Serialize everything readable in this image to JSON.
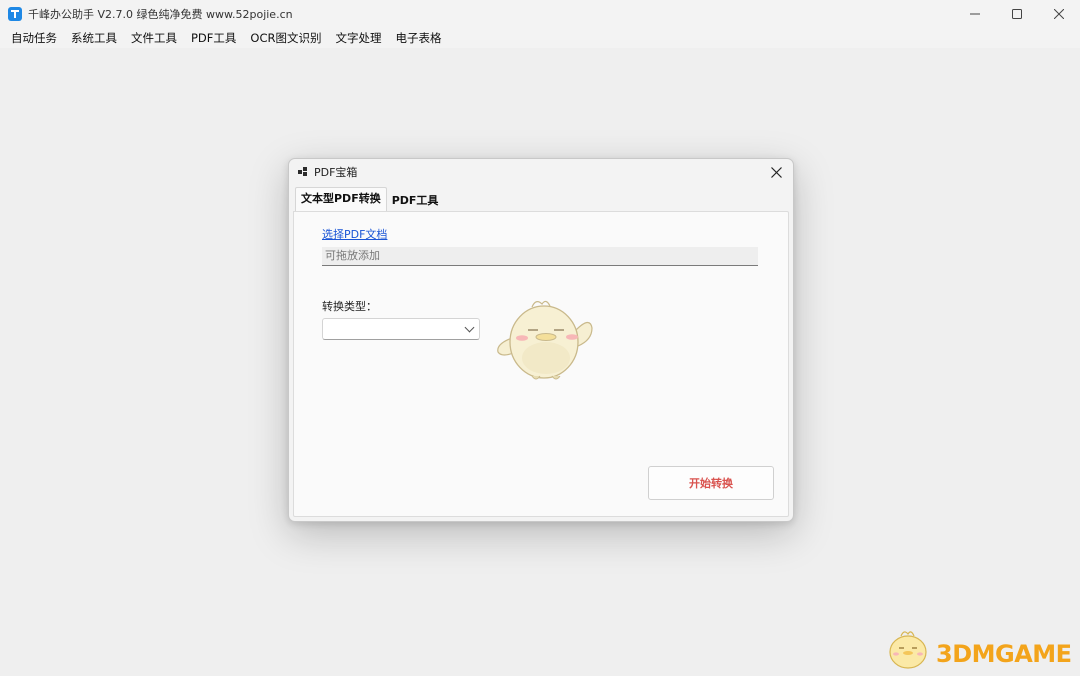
{
  "window": {
    "title": "千峰办公助手 V2.7.0  绿色纯净免费  www.52pojie.cn",
    "controls": [
      "minimize-icon",
      "maximize-icon",
      "close-icon"
    ]
  },
  "menu": {
    "items": [
      {
        "label": "自动任务"
      },
      {
        "label": "系统工具"
      },
      {
        "label": "文件工具"
      },
      {
        "label": "PDF工具"
      },
      {
        "label": "OCR图文识别"
      },
      {
        "label": "文字处理"
      },
      {
        "label": "电子表格"
      }
    ]
  },
  "dialog": {
    "title": "PDF宝箱",
    "tabs": [
      {
        "label": "文本型PDF转换",
        "active": true
      },
      {
        "label": "PDF工具",
        "active": false
      }
    ],
    "select_link": "选择PDF文档",
    "drop_placeholder": "可拖放添加",
    "conversion_label": "转换类型：",
    "conversion_value": "",
    "start_button": "开始转换"
  },
  "watermark": {
    "text": "3DMGAME"
  },
  "colors": {
    "accent": "#1e88e5",
    "link": "#1a55d6",
    "start_button_text": "#d9534f",
    "watermark": "#f3a41b"
  }
}
